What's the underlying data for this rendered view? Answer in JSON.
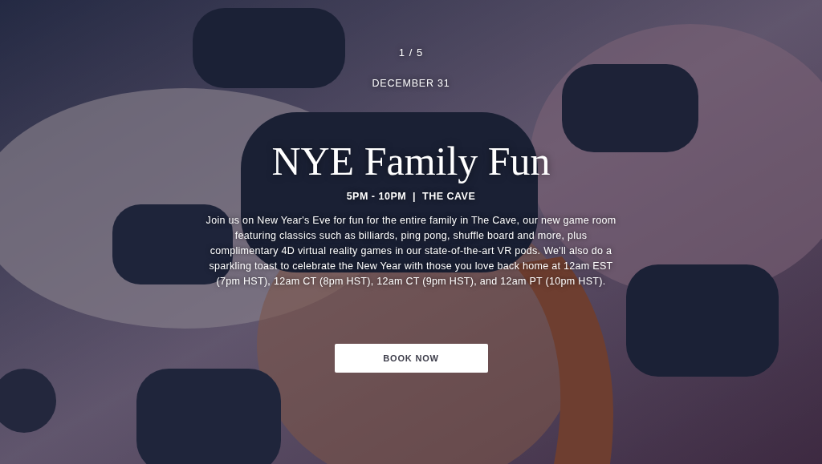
{
  "hero": {
    "slide_counter": "1 / 5",
    "date": "DECEMBER 31",
    "title": "NYE Family Fun",
    "details": "5PM - 10PM  |  THE CAVE",
    "description": "Join us on New Year's Eve for fun for the entire family in The Cave, our new game room featuring classics such as billiards, ping pong, shuffle board and more, plus complimentary 4D virtual reality games in our state-of-the-art VR pods. We'll also do a sparkling toast to celebrate the New Year with those you love back home at 12am EST (7pm HST), 12am CT (8pm HST), 12am CT (9pm HST), and 12am PT (10pm HST).",
    "button": "BOOK NOW"
  }
}
